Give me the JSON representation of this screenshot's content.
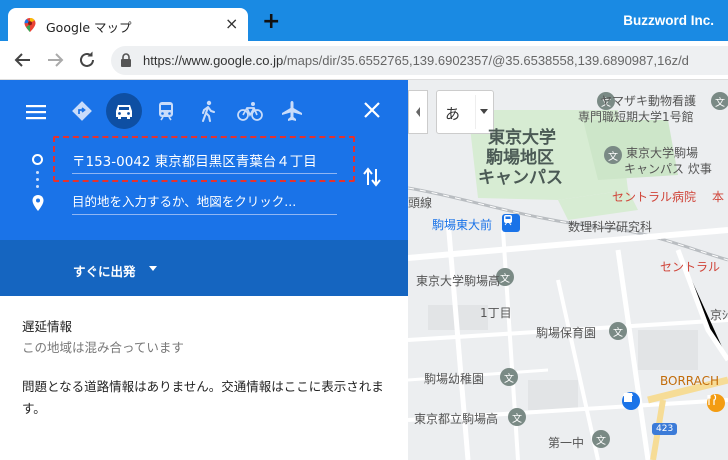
{
  "browser": {
    "tab_title": "Google マップ",
    "tab_close": "×",
    "new_tab": "+",
    "brand": "Buzzword Inc.",
    "url_host": "https://www.google.co.jp",
    "url_path": "/maps/dir/35.6552765,139.6902357/@35.6538558,139.6890987,16z/d"
  },
  "panel": {
    "origin_value": "〒153-0042 東京都目黒区青葉台４丁目",
    "destination_placeholder": "目的地を入力するか、地図をクリック...",
    "depart_label": "すぐに出発",
    "traffic_title": "遅延情報",
    "traffic_subtitle": "この地域は混み合っています",
    "traffic_body": "問題となる道路情報はありません。交通情報はここに表示されます。"
  },
  "map": {
    "ime_label": "あ",
    "labels": {
      "yamazaki": "ヤマザキ動物看護",
      "yamazaki2": "専門職短期大学1号館",
      "campus": "東京大学",
      "campus2": "駒場地区",
      "campus3": "キャンパス",
      "todai_poi": "東京大学駒場",
      "todai_poi2": "キャンパス 炊事",
      "central": "セントラル病院",
      "central_suffix": "本",
      "central2": "セントラル",
      "station": "駒場東大前",
      "line": "頭線",
      "suuri": "数理科学研究科",
      "highschool": "東京大学駒場高",
      "chome": "1丁目",
      "kyou": "京ｼ",
      "hoikuen": "駒場保育園",
      "youchien": "駒場幼稚園",
      "borracho": "BORRACH",
      "kokuritsu": "東京都立駒場高",
      "daiichi": "第一中",
      "route_num": "423"
    },
    "colors": {
      "park": "#c9e8c5",
      "road": "#ffffff",
      "highlight_road": "#f8e0a0"
    }
  },
  "colors": {
    "panel_blue": "#1a73e8",
    "depart_blue": "#1565c0",
    "chrome_blue": "#1a8ae3",
    "highlight_dashed": "#e5322d"
  }
}
